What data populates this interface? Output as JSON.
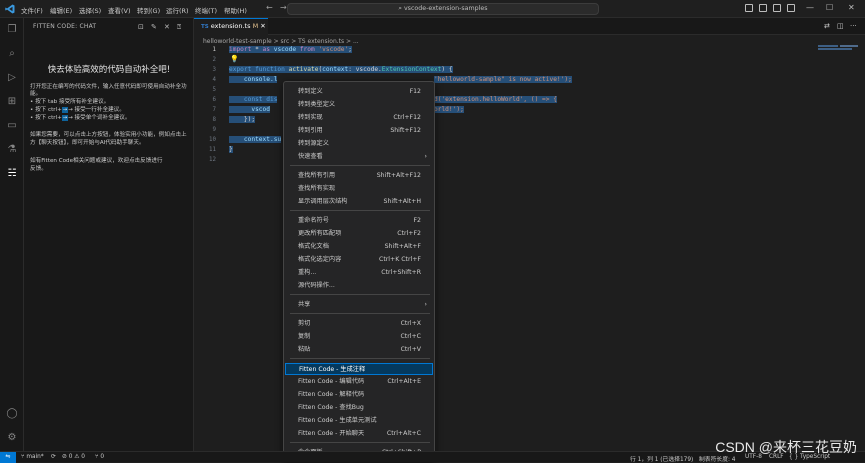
{
  "titlebar": {
    "menus": [
      "文件(F)",
      "编辑(E)",
      "选择(S)",
      "查看(V)",
      "转到(G)",
      "运行(R)",
      "终端(T)",
      "帮助(H)"
    ],
    "search": "vscode-extension-samples",
    "logo_icon": "vscode-logo",
    "accent": "#0078d4"
  },
  "sidebar": {
    "header": "FITTEN CODE: CHAT",
    "title": "快去体验高效的代码自动补全吧!",
    "lines": [
      "  打开您正在编写的代码文件，输入任意代码即可使用自动补全功",
      "能。",
      "  • 按下 tab 接受所有补全建议。",
      "  • 按下 ctrl+",
      "  • 按下 ctrl+",
      "  如果您需要，可以点击上方按钮，体验实用小功能，例如点击上",
      "方【聊天按钮】，即可开始与AI代码助手聊天。",
      "  如有Fitten Code相关问题或建议，欢迎点击反馈进行",
      "反馈。"
    ],
    "kbd_next_line": "→ 接受一行补全建议。",
    "kbd_next_word": "→ 接受单个词补全建议。"
  },
  "editor": {
    "tab_label": "extension.ts",
    "tab_mod": "M",
    "tab_lang": "TS",
    "breadcrumb": "helloworld-test-sample  >  src  >  TS  extension.ts  >  ...",
    "line_numbers": [
      "1",
      "2",
      "3",
      "4",
      "5",
      "6",
      "7",
      "8",
      "9",
      "10",
      "11",
      "12"
    ],
    "code": {
      "l1a": "import",
      "l1b": " * ",
      "l1c": "as",
      "l1d": " vscode ",
      "l1e": "from",
      "l1f": " 'vscode'",
      "l1g": ";",
      "l4a": "export",
      "l4b": " function ",
      "l4c": "activate",
      "l4d": "(",
      "l4e": "context",
      "l4f": ": vscode.",
      "l4g": "ExtensionContext",
      "l4h": ") {",
      "l5": "    console.l",
      "l5r": "'helloworld-sample\" is now active!');",
      "l7": "    const dis",
      "l7r": "d('extension.helloWorld', () => {",
      "l8": "      vscod",
      "l8r": "orld!');",
      "l9": "    });",
      "l11": "    context.su",
      "l12": "}"
    }
  },
  "context_menu": {
    "items": [
      {
        "label": "转到定义",
        "shortcut": "F12"
      },
      {
        "label": "转到类型定义",
        "shortcut": ""
      },
      {
        "label": "转到实现",
        "shortcut": "Ctrl+F12"
      },
      {
        "label": "转到引用",
        "shortcut": "Shift+F12"
      },
      {
        "label": "转到源定义",
        "shortcut": ""
      },
      {
        "label": "快速查看",
        "shortcut": ""
      },
      {
        "label": "查找所有引用",
        "shortcut": "Shift+Alt+F12"
      },
      {
        "label": "查找所有实现",
        "shortcut": ""
      },
      {
        "label": "显示调用层次结构",
        "shortcut": "Shift+Alt+H"
      },
      {
        "label": "重命名符号",
        "shortcut": "F2"
      },
      {
        "label": "更改所有匹配项",
        "shortcut": "Ctrl+F2"
      },
      {
        "label": "格式化文档",
        "shortcut": "Shift+Alt+F"
      },
      {
        "label": "格式化选定内容",
        "shortcut": "Ctrl+K Ctrl+F"
      },
      {
        "label": "重构...",
        "shortcut": "Ctrl+Shift+R"
      },
      {
        "label": "源代码操作...",
        "shortcut": ""
      },
      {
        "label": "共享",
        "shortcut": ""
      },
      {
        "label": "剪切",
        "shortcut": "Ctrl+X"
      },
      {
        "label": "复制",
        "shortcut": "Ctrl+C"
      },
      {
        "label": "粘贴",
        "shortcut": "Ctrl+V"
      },
      {
        "label": "Fitten Code - 生成注释",
        "shortcut": ""
      },
      {
        "label": "Fitten Code - 编辑代码",
        "shortcut": "Ctrl+Alt+E"
      },
      {
        "label": "Fitten Code - 解释代码",
        "shortcut": ""
      },
      {
        "label": "Fitten Code - 查找Bug",
        "shortcut": ""
      },
      {
        "label": "Fitten Code - 生成单元测试",
        "shortcut": ""
      },
      {
        "label": "Fitten Code - 开始聊天",
        "shortcut": "Ctrl+Alt+C"
      },
      {
        "label": "命令面板...",
        "shortcut": "Ctrl+Shift+P"
      }
    ],
    "highlight_color": "#04395e"
  },
  "statusbar": {
    "branch": "main*",
    "errors": "⊘ 0 ⚠ 0",
    "ports": "⑂ 0",
    "position": "行 1，列 1 (已选择179)",
    "indent": "制表符长度: 4",
    "encoding": "UTF-8",
    "eol": "CRLF",
    "lang": "{ } TypeScript"
  },
  "watermark": "CSDN @来杯三花豆奶"
}
